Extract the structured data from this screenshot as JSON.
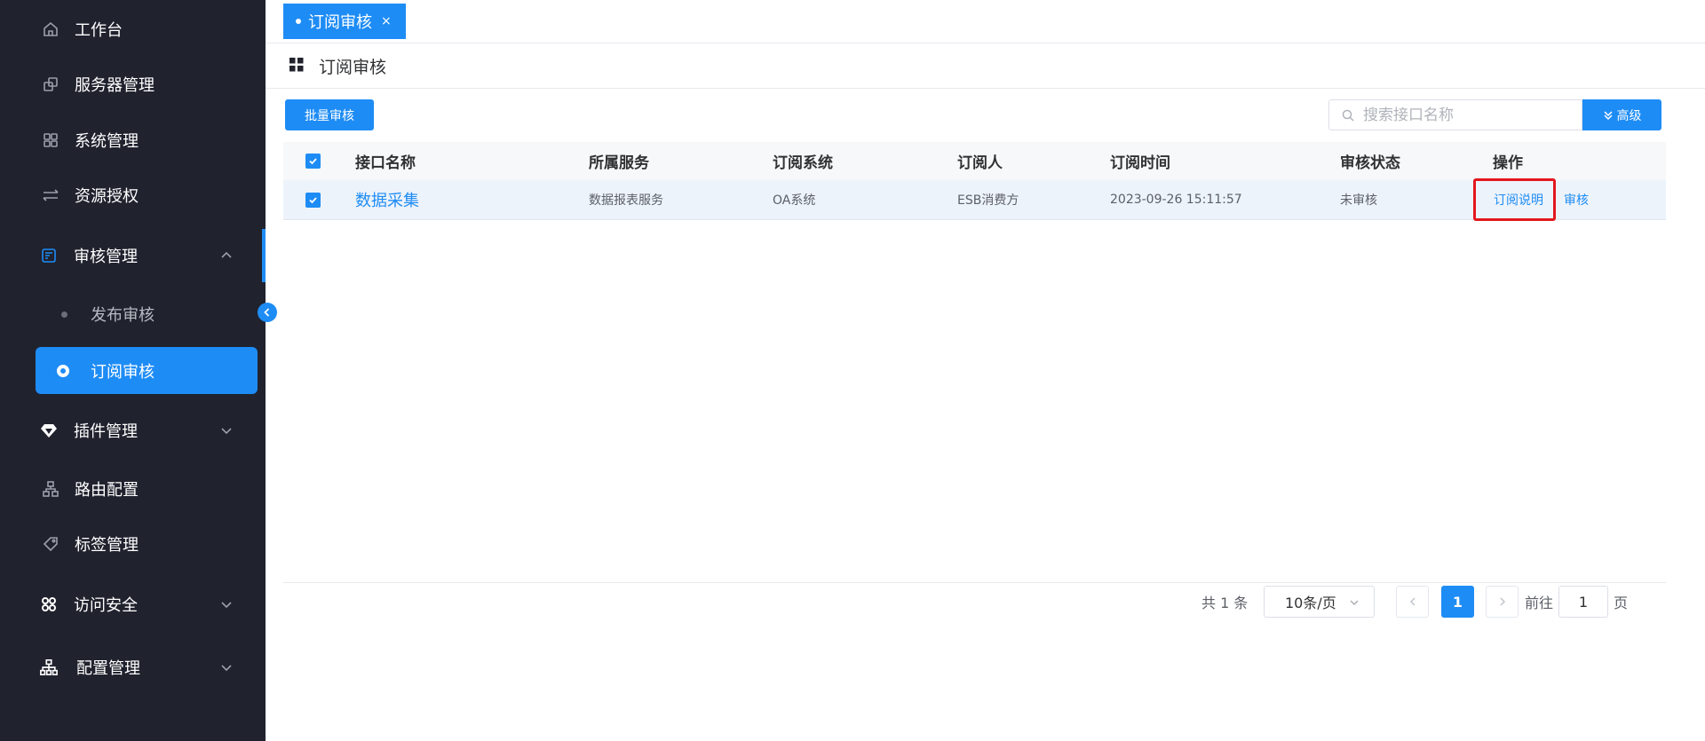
{
  "sidebar": {
    "items": [
      {
        "label": "工作台",
        "icon": "home-icon"
      },
      {
        "label": "服务器管理",
        "icon": "server-icon"
      },
      {
        "label": "系统管理",
        "icon": "apps-icon"
      },
      {
        "label": "资源授权",
        "icon": "transfer-icon"
      },
      {
        "label": "审核管理",
        "icon": "audit-icon"
      },
      {
        "label": "插件管理",
        "icon": "plugin-icon"
      },
      {
        "label": "路由配置",
        "icon": "route-icon"
      },
      {
        "label": "标签管理",
        "icon": "tag-icon"
      },
      {
        "label": "访问安全",
        "icon": "security-icon"
      },
      {
        "label": "配置管理",
        "icon": "config-icon"
      }
    ],
    "sub_items": [
      {
        "label": "发布审核"
      },
      {
        "label": "订阅审核"
      }
    ]
  },
  "tabs": [
    {
      "label": "订阅审核",
      "close": "×"
    }
  ],
  "page": {
    "title": "订阅审核"
  },
  "toolbar": {
    "batch_label": "批量审核",
    "search_placeholder": "搜索接口名称",
    "advanced_label": "高级"
  },
  "table": {
    "columns": [
      "接口名称",
      "所属服务",
      "订阅系统",
      "订阅人",
      "订阅时间",
      "审核状态",
      "操作"
    ],
    "rows": [
      {
        "name": "数据采集",
        "service": "数据报表服务",
        "system": "OA系统",
        "subscriber": "ESB消费方",
        "time": "2023-09-26 15:11:57",
        "status": "未审核",
        "actions": [
          "订阅说明",
          "审核"
        ]
      }
    ]
  },
  "pagination": {
    "total_text": "共 1 条",
    "page_size": "10条/页",
    "current_page": "1",
    "goto_prefix": "前往",
    "goto_value": "1",
    "goto_suffix": "页"
  },
  "colors": {
    "accent": "#1e8cf5",
    "sidebar_bg": "#20222e",
    "highlight": "#e3171e"
  }
}
